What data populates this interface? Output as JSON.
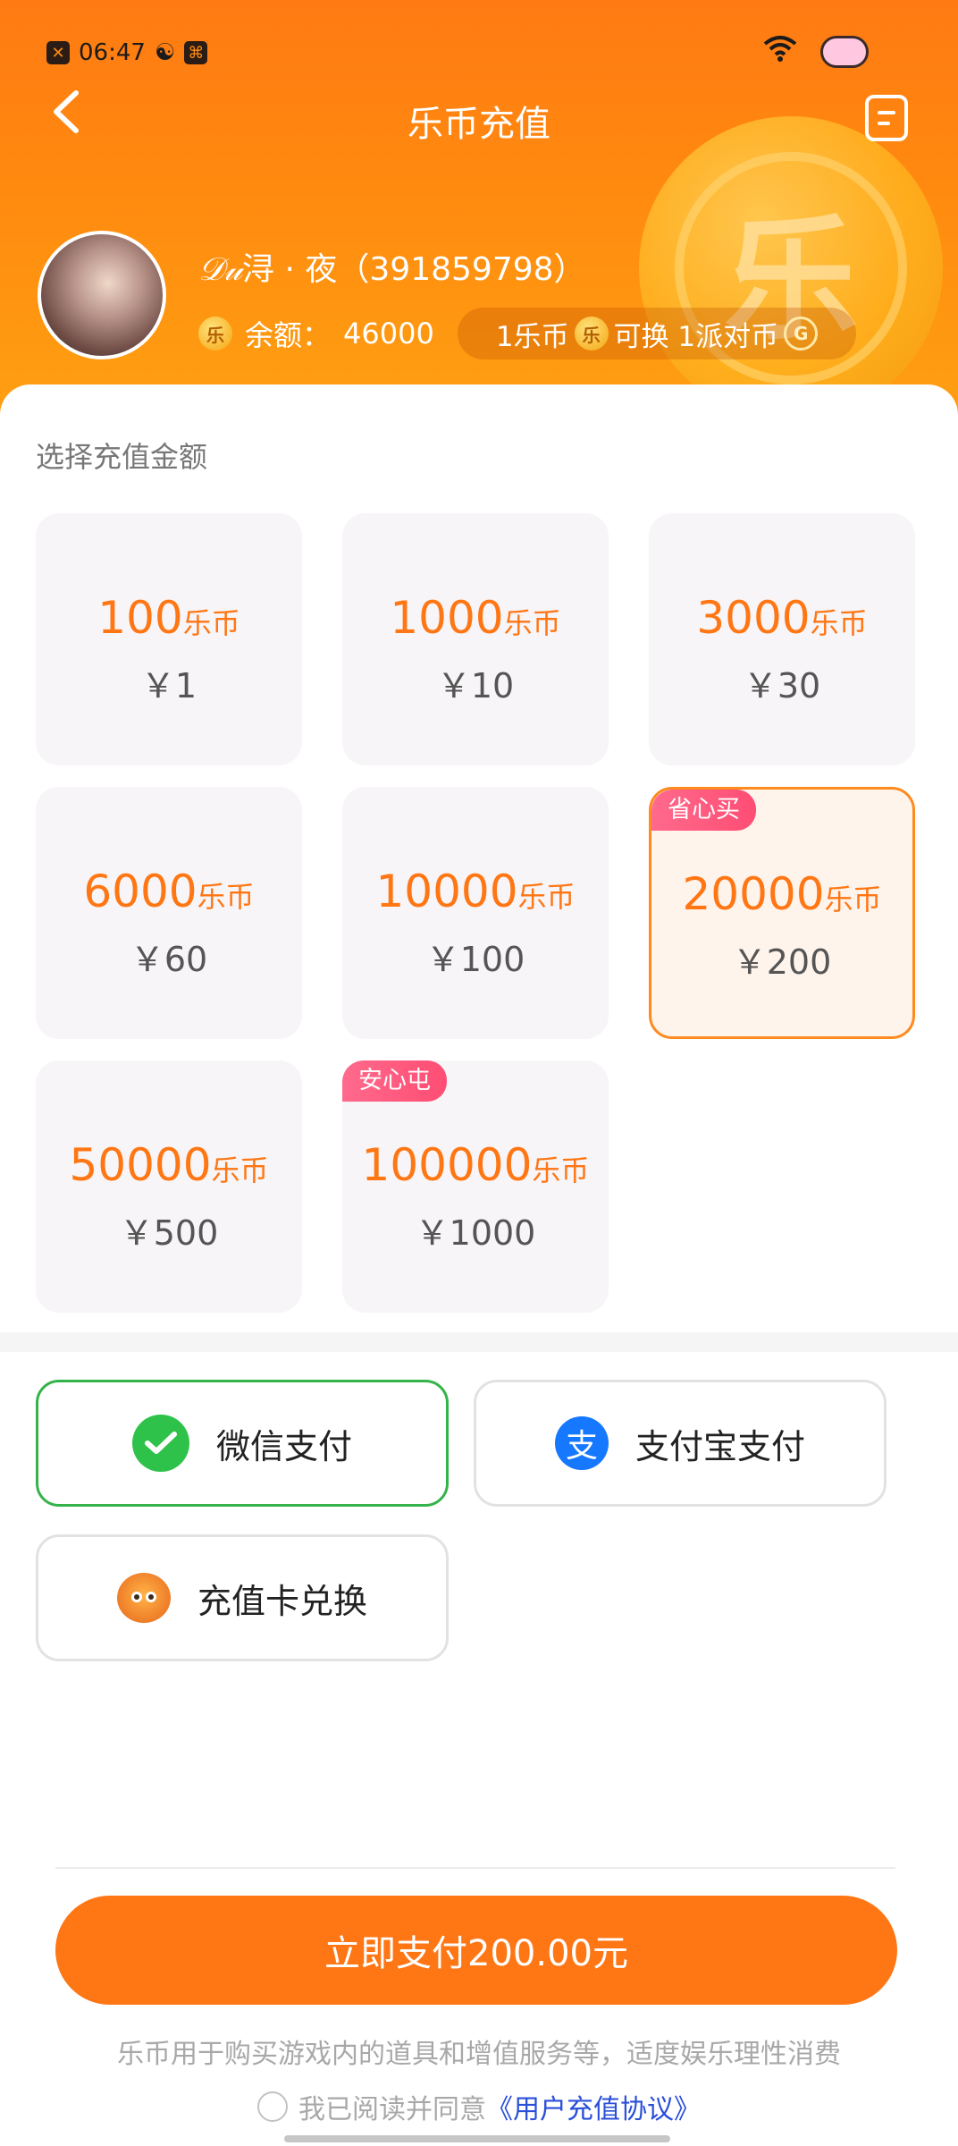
{
  "status_bar": {
    "time": "06:47"
  },
  "nav": {
    "title": "乐币充值"
  },
  "profile": {
    "name_fancy": "𝒟𝓊",
    "name": "浔 · 夜",
    "uid": "（391859798）",
    "coin_symbol": "乐",
    "balance_label": "余额：",
    "balance_value": "46000",
    "rate_left": "1乐币",
    "rate_mid": "可换 1派对币",
    "party_coin_symbol": "G",
    "big_coin_symbol": "乐"
  },
  "section_title": "选择充值金额",
  "packages": [
    {
      "coins": "100",
      "unit": "乐币",
      "price": "￥1",
      "tag": ""
    },
    {
      "coins": "1000",
      "unit": "乐币",
      "price": "￥10",
      "tag": ""
    },
    {
      "coins": "3000",
      "unit": "乐币",
      "price": "￥30",
      "tag": ""
    },
    {
      "coins": "6000",
      "unit": "乐币",
      "price": "￥60",
      "tag": ""
    },
    {
      "coins": "10000",
      "unit": "乐币",
      "price": "￥100",
      "tag": ""
    },
    {
      "coins": "20000",
      "unit": "乐币",
      "price": "￥200",
      "tag": "省心买",
      "selected": true
    },
    {
      "coins": "50000",
      "unit": "乐币",
      "price": "￥500",
      "tag": ""
    },
    {
      "coins": "100000",
      "unit": "乐币",
      "price": "￥1000",
      "tag": "安心屯"
    }
  ],
  "payment_methods": [
    {
      "label": "微信支付",
      "icon": "wechat-icon",
      "selected": true
    },
    {
      "label": "支付宝支付",
      "icon": "alipay-icon",
      "selected": false
    },
    {
      "label": "充值卡兑换",
      "icon": "recharge-card-icon",
      "selected": false
    }
  ],
  "alipay_icon_glyph": "支",
  "pay_button": "立即支付200.00元",
  "note": "乐币用于购买游戏内的道具和增值服务等，适度娱乐理性消费",
  "agreement": {
    "prefix": "我已阅读并同意",
    "link": "《用户充值协议》"
  },
  "colors": {
    "accent": "#ff7614",
    "selected_border": "#ff8a1e",
    "wechat_selected": "#34b34a",
    "link": "#2a4fd9"
  }
}
